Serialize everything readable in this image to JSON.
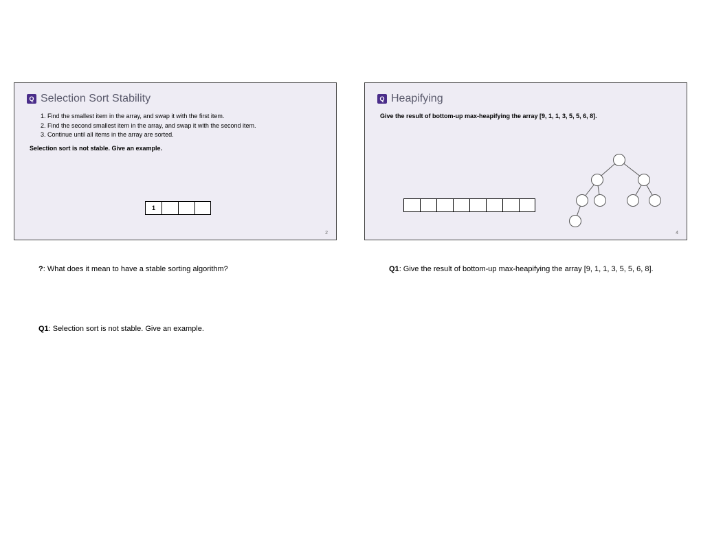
{
  "left": {
    "badge": "Q",
    "title": "Selection Sort Stability",
    "steps": [
      "Find the smallest item in the array, and swap it with the first item.",
      "Find the second smallest item in the array, and swap it with the second item.",
      "Continue until all items in the array are sorted."
    ],
    "prompt": "Selection sort is not stable. Give an example.",
    "cells": [
      "1",
      "",
      "",
      ""
    ],
    "page_num": "2",
    "notes": [
      {
        "label": "?",
        "text": ": What does it mean to have a stable sorting algorithm?"
      },
      {
        "label": "Q1",
        "text": ": Selection sort is not stable. Give an example."
      }
    ]
  },
  "right": {
    "badge": "Q",
    "title": "Heapifying",
    "prompt": "Give the result of bottom-up max-heapifying the array [9, 1, 1, 3, 5, 5, 6, 8].",
    "cells": [
      "",
      "",
      "",
      "",
      "",
      "",
      "",
      ""
    ],
    "page_num": "4",
    "notes": [
      {
        "label": "Q1",
        "text": ": Give the result of bottom-up max-heapifying the array [9, 1, 1, 3, 5, 5, 6, 8]."
      }
    ]
  }
}
